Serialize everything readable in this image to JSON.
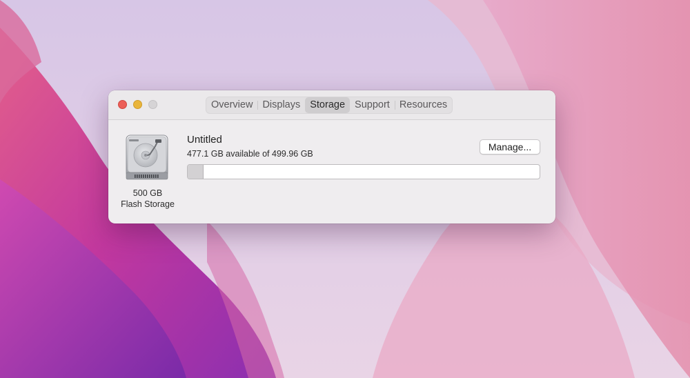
{
  "window": {
    "traffic_lights": [
      "close",
      "minimize",
      "zoom"
    ]
  },
  "tabs": [
    {
      "label": "Overview",
      "active": false
    },
    {
      "label": "Displays",
      "active": false
    },
    {
      "label": "Storage",
      "active": true
    },
    {
      "label": "Support",
      "active": false
    },
    {
      "label": "Resources",
      "active": false
    }
  ],
  "drive": {
    "icon": "hard-drive-icon",
    "capacity_label": "500 GB",
    "type_label": "Flash Storage"
  },
  "volume": {
    "name": "Untitled",
    "availability": "477.1 GB available of 499.96 GB",
    "used_fraction": 0.046,
    "manage_label": "Manage..."
  },
  "colors": {
    "close": "#ec5f58",
    "minimize": "#e9b53c",
    "zoom_disabled": "#d6d4d6",
    "window_bg": "#efedef"
  }
}
